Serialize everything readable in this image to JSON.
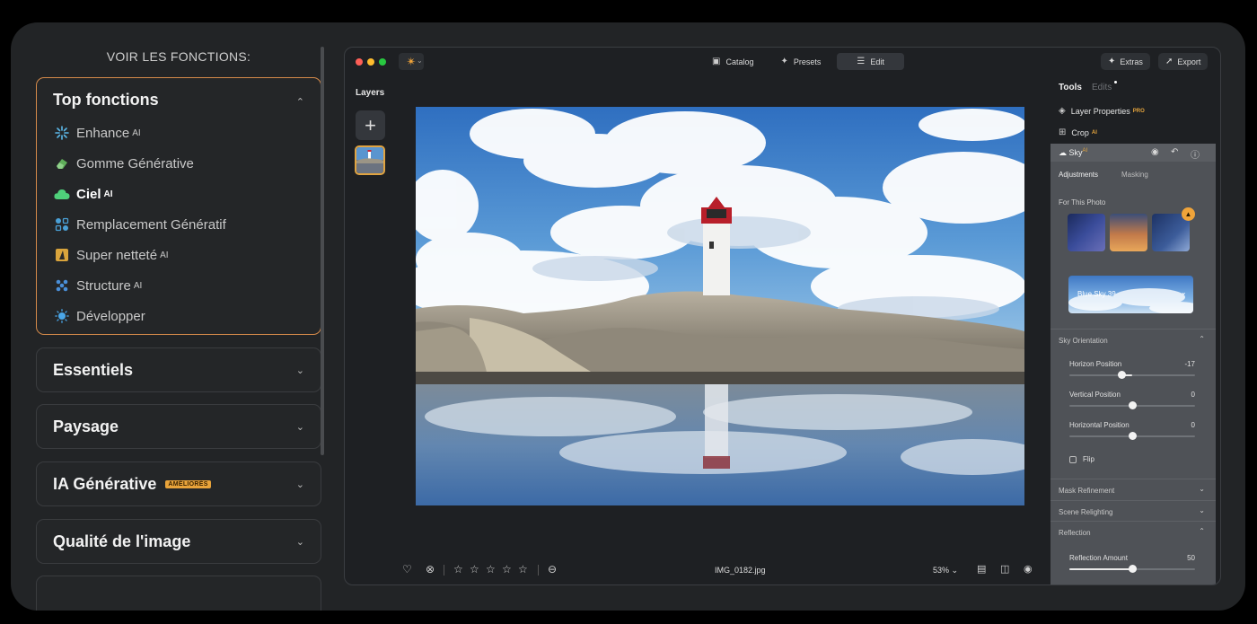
{
  "promo": {
    "heading": "VOIR LES FONCTIONS:",
    "open_card": {
      "title": "Top fonctions",
      "items": [
        {
          "label": "Enhance",
          "sup": "AI",
          "icon": "sparkle-icon"
        },
        {
          "label": "Gomme Générative",
          "sup": "",
          "icon": "eraser-icon"
        },
        {
          "label": "Ciel",
          "sup": "AI",
          "icon": "cloud-icon",
          "active": true
        },
        {
          "label": "Remplacement Génératif",
          "sup": "",
          "icon": "replace-icon"
        },
        {
          "label": "Super netteté",
          "sup": "AI",
          "icon": "triangle-icon"
        },
        {
          "label": "Structure",
          "sup": "AI",
          "icon": "structure-icon"
        },
        {
          "label": "Développer",
          "sup": "",
          "icon": "sun-icon"
        }
      ]
    },
    "cards": [
      {
        "title": "Essentiels",
        "badge": ""
      },
      {
        "title": "Paysage",
        "badge": ""
      },
      {
        "title": "IA Générative",
        "badge": "AMÉLIORÉS"
      },
      {
        "title": "Qualité de l'image",
        "badge": ""
      }
    ]
  },
  "app": {
    "nav": {
      "catalog": "Catalog",
      "presets": "Presets",
      "edit": "Edit"
    },
    "extras": "Extras",
    "export": "Export",
    "layers_label": "Layers",
    "filename": "IMG_0182.jpg",
    "zoom": "53%",
    "tools": {
      "tools_tab": "Tools",
      "edits_tab": "Edits",
      "layer_properties": "Layer Properties",
      "layer_properties_badge": "PRO",
      "crop": "Crop",
      "crop_badge": "AI",
      "sky": "Sky",
      "sky_badge": "AI",
      "sky_tabs": {
        "adjustments": "Adjustments",
        "masking": "Masking"
      },
      "for_this_photo": "For This Photo",
      "selected_sky": "Blue Sky 39",
      "sky_orientation": "Sky Orientation",
      "sliders": [
        {
          "label": "Horizon Position",
          "value": "-17",
          "range": [
            -100,
            100
          ],
          "num": -17
        },
        {
          "label": "Vertical Position",
          "value": "0",
          "range": [
            -100,
            100
          ],
          "num": 0
        },
        {
          "label": "Horizontal Position",
          "value": "0",
          "range": [
            -100,
            100
          ],
          "num": 0
        }
      ],
      "flip": "Flip",
      "mask_refinement": "Mask Refinement",
      "scene_relighting": "Scene Relighting",
      "reflection": "Reflection",
      "reflection_amount": {
        "label": "Reflection Amount",
        "value": "50",
        "range": [
          0,
          100
        ],
        "num": 50
      }
    },
    "colors": {
      "accent": "#e1a441",
      "window": "#1e2023",
      "panel": "#4f5257"
    }
  }
}
